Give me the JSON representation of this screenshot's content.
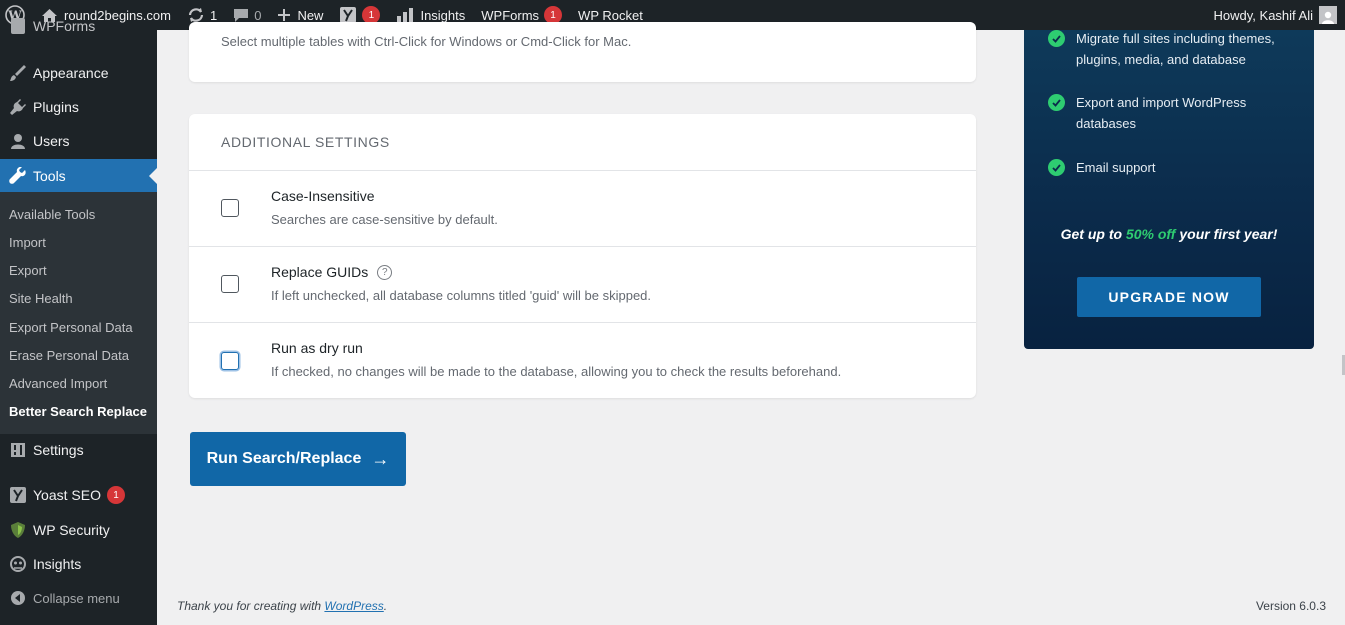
{
  "admin_bar": {
    "site_name": "round2begins.com",
    "updates_count": "1",
    "comments_count": "0",
    "new_label": "New",
    "yoast_badge": "1",
    "insights_label": "Insights",
    "wpforms_label": "WPForms",
    "wpforms_badge": "1",
    "wprocket_label": "WP Rocket",
    "howdy": "Howdy, Kashif Ali"
  },
  "sidebar": {
    "items": [
      {
        "label": "WPForms"
      },
      {
        "label": "Appearance"
      },
      {
        "label": "Plugins"
      },
      {
        "label": "Users"
      },
      {
        "label": "Tools"
      },
      {
        "label": "Settings"
      },
      {
        "label": "Yoast SEO",
        "badge": "1"
      },
      {
        "label": "WP Security"
      },
      {
        "label": "Insights"
      },
      {
        "label": "Collapse menu"
      }
    ],
    "tools_submenu": [
      "Available Tools",
      "Import",
      "Export",
      "Site Health",
      "Export Personal Data",
      "Erase Personal Data",
      "Advanced Import",
      "Better Search Replace"
    ]
  },
  "tables_card": {
    "hint": "Select multiple tables with Ctrl-Click for Windows or Cmd-Click for Mac."
  },
  "settings": {
    "title": "ADDITIONAL SETTINGS",
    "options": [
      {
        "title": "Case-Insensitive",
        "desc": "Searches are case-sensitive by default.",
        "checked": false
      },
      {
        "title": "Replace GUIDs",
        "desc": "If left unchecked, all database columns titled 'guid' will be skipped.",
        "checked": false
      },
      {
        "title": "Run as dry run",
        "desc": "If checked, no changes will be made to the database, allowing you to check the results beforehand.",
        "checked": false
      }
    ]
  },
  "run_button": {
    "label": "Run Search/Replace",
    "arrow": "→"
  },
  "promo": {
    "features": [
      "Migrate full sites including themes, plugins, media, and database",
      "Export and import WordPress databases",
      "Email support"
    ],
    "offer_prefix": "Get up to",
    "offer_highlight": "50% off",
    "offer_suffix": "your first year!",
    "upgrade_label": "UPGRADE NOW",
    "accent": "#2ecc71"
  },
  "footer": {
    "thanks_prefix": "Thank you for creating with",
    "link_text": "WordPress",
    "thanks_suffix": ".",
    "version": "Version 6.0.3"
  }
}
